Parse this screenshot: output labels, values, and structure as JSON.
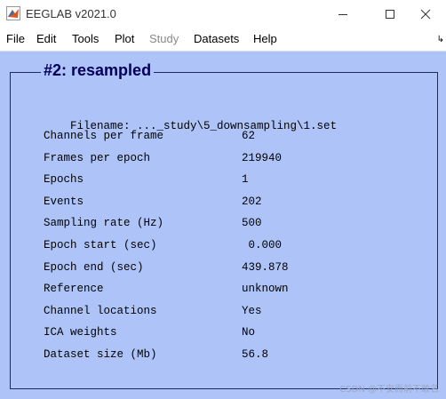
{
  "window": {
    "title": "EEGLAB v2021.0",
    "icon": "matlab-icon"
  },
  "menu": [
    {
      "label": "File",
      "enabled": true
    },
    {
      "label": "Edit",
      "enabled": true
    },
    {
      "label": "Tools",
      "enabled": true
    },
    {
      "label": "Plot",
      "enabled": true
    },
    {
      "label": "Study",
      "enabled": false
    },
    {
      "label": "Datasets",
      "enabled": true
    },
    {
      "label": "Help",
      "enabled": true
    }
  ],
  "panel": {
    "title": "#2:  resampled",
    "filename": "Filename: ..._study\\5_downsampling\\1.set",
    "rows": [
      {
        "label": "Channels per frame",
        "value": "62"
      },
      {
        "label": "Frames per epoch",
        "value": "219940"
      },
      {
        "label": "Epochs",
        "value": "1"
      },
      {
        "label": "Events",
        "value": "202"
      },
      {
        "label": "Sampling rate (Hz)",
        "value": "500"
      },
      {
        "label": "Epoch start (sec)",
        "value": " 0.000"
      },
      {
        "label": "Epoch end (sec)",
        "value": "439.878"
      },
      {
        "label": "Reference",
        "value": "unknown"
      },
      {
        "label": "Channel locations",
        "value": "Yes"
      },
      {
        "label": "ICA weights",
        "value": "No"
      },
      {
        "label": "Dataset size (Mb)",
        "value": "56.8"
      }
    ]
  },
  "watermark": "CSDN @不安而前不敢名",
  "colors": {
    "background": "#aec4f8",
    "title": "#00005a"
  }
}
